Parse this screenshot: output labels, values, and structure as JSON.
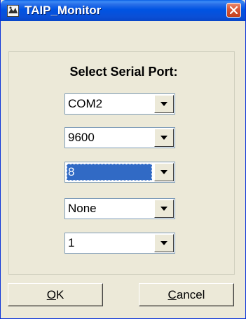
{
  "window": {
    "title": "TAIP_Monitor"
  },
  "panel": {
    "heading": "Select Serial Port:"
  },
  "selects": [
    {
      "value": "COM2"
    },
    {
      "value": "9600"
    },
    {
      "value": "8",
      "focused": true
    },
    {
      "value": "None"
    },
    {
      "value": "1"
    }
  ],
  "buttons": {
    "ok": {
      "accel": "O",
      "rest": "K"
    },
    "cancel": {
      "accel": "C",
      "rest": "ancel"
    }
  },
  "colors": {
    "titlebar": "#0054e3",
    "close": "#d9593a",
    "selection": "#316ac5",
    "face": "#ece9d8"
  }
}
